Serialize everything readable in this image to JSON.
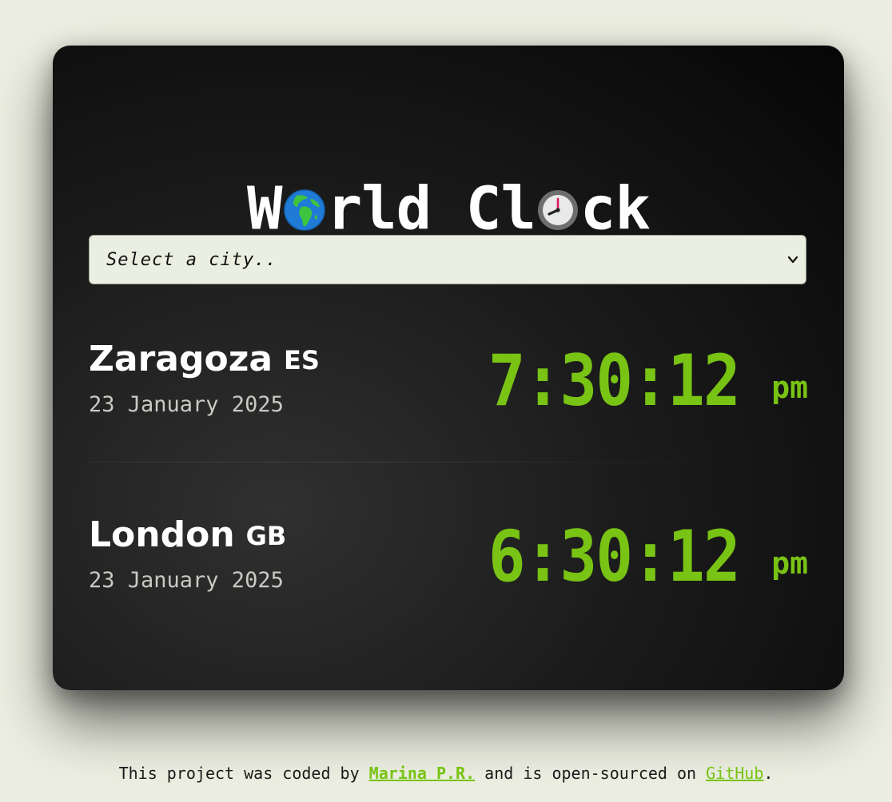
{
  "app": {
    "title_part1": "W",
    "title_part2": "rld Cl",
    "title_part3": "ck",
    "title_icons": [
      "globe-africa-europe-icon",
      "eight-oclock-clock-icon"
    ]
  },
  "city_select": {
    "placeholder": "Select a city..",
    "icon": "chevron-down-icon"
  },
  "cities": [
    {
      "name": "Zaragoza",
      "country_code": "ES",
      "date": "23 January 2025",
      "time": "7:30:12",
      "ampm": "PM"
    },
    {
      "name": "London",
      "country_code": "GB",
      "date": "23 January 2025",
      "time": "6:30:12",
      "ampm": "PM"
    }
  ],
  "footer": {
    "text_before": "This project was coded by ",
    "author_link": "Marina P.R.",
    "text_middle": " and is open-sourced on ",
    "github_link": "GitHub",
    "text_after": "."
  },
  "colors": {
    "page_background": "#ebeee0",
    "card_background": "#1b1b1b",
    "clock_green": "#78c314",
    "select_background": "#ebefe1"
  }
}
